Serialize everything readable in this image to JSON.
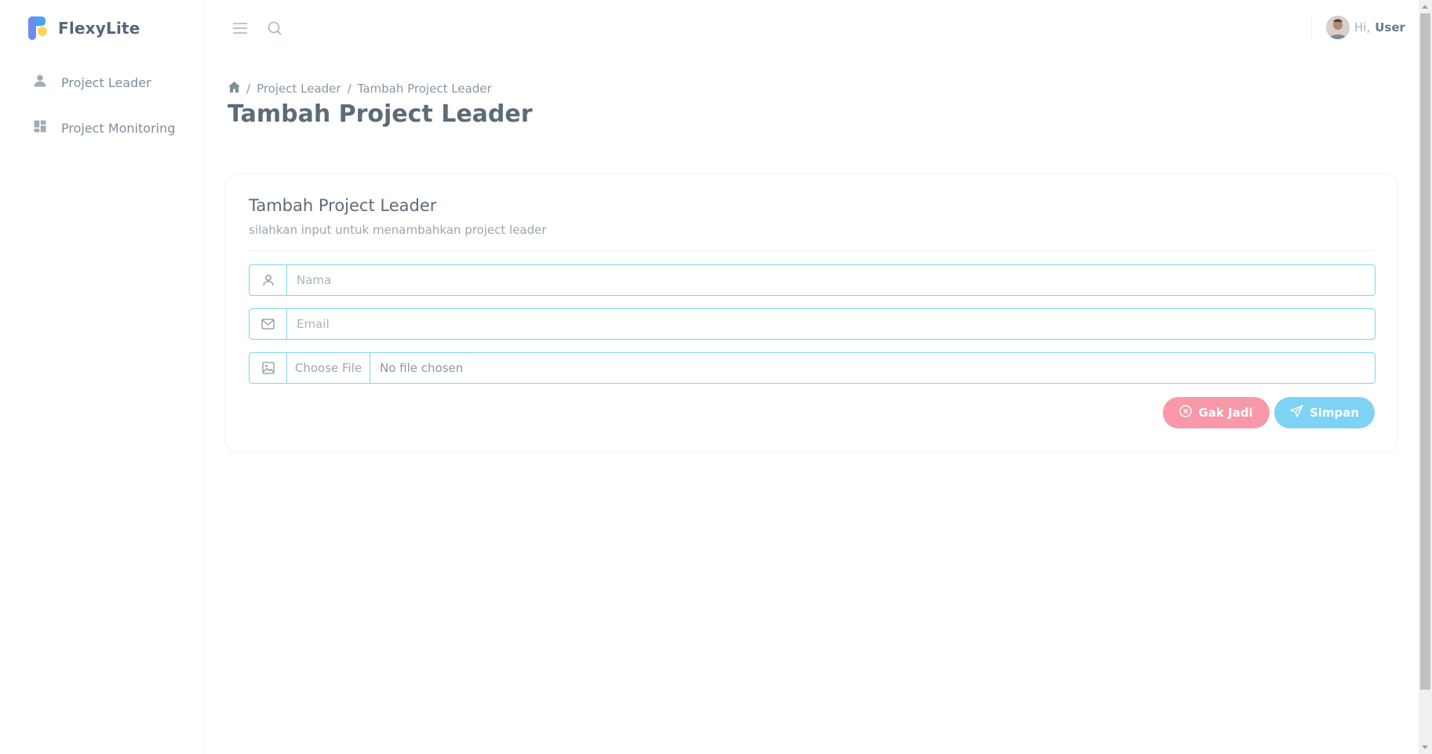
{
  "brand": {
    "name": "FlexyLite"
  },
  "sidebar": {
    "items": [
      {
        "label": "Project Leader",
        "icon": "person-icon"
      },
      {
        "label": "Project Monitoring",
        "icon": "dashboard-icon"
      }
    ]
  },
  "topbar": {
    "menu_icon": "hamburger-icon",
    "search_icon": "search-icon",
    "user": {
      "greeting": "Hi,",
      "name": "User"
    }
  },
  "breadcrumb": {
    "home_icon": "home-icon",
    "items": [
      "Project Leader",
      "Tambah Project Leader"
    ]
  },
  "page": {
    "title": "Tambah Project Leader"
  },
  "card": {
    "title": "Tambah Project Leader",
    "subtitle": "silahkan input untuk menambahkan project leader",
    "fields": {
      "nama": {
        "placeholder": "Nama",
        "value": "",
        "icon": "user-outline-icon"
      },
      "email": {
        "placeholder": "Email",
        "value": "",
        "icon": "mail-icon"
      },
      "file": {
        "button_label": "Choose File",
        "status": "No file chosen",
        "icon": "image-icon"
      }
    },
    "buttons": {
      "cancel": {
        "label": "Gak Jadi",
        "icon": "x-circle-icon",
        "color": "#f898a8"
      },
      "save": {
        "label": "Simpan",
        "icon": "send-icon",
        "color": "#7ed2f3"
      }
    }
  },
  "colors": {
    "accent": "#7fd3ec",
    "danger": "#f898a8",
    "info": "#7ed2f3"
  }
}
